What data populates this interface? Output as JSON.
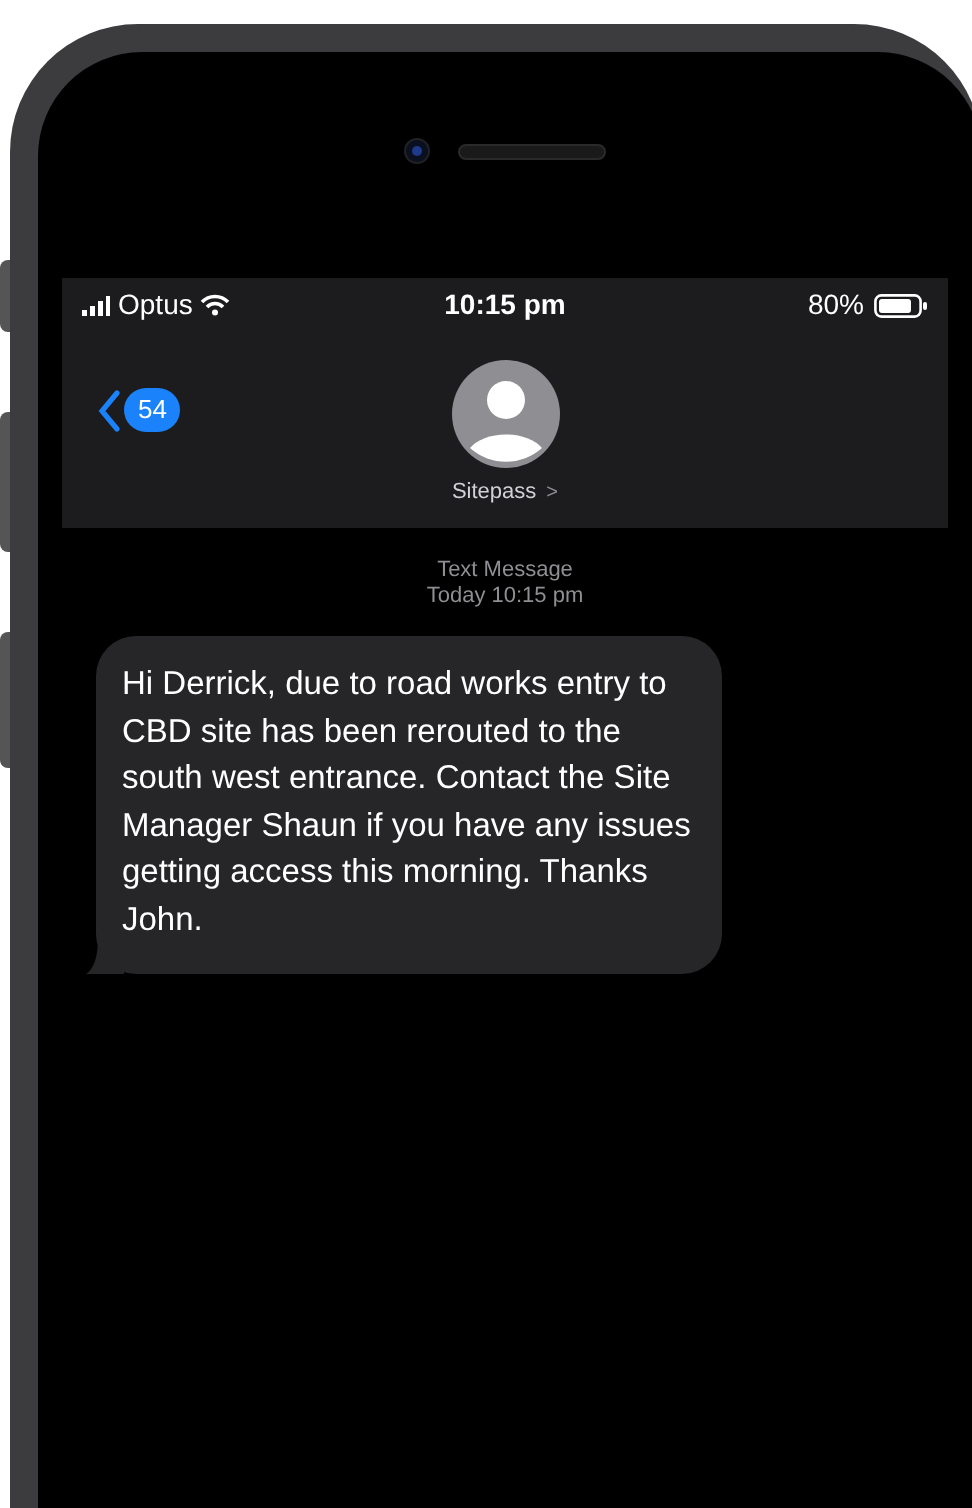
{
  "status_bar": {
    "carrier": "Optus",
    "time": "10:15 pm",
    "battery": "80%"
  },
  "header": {
    "back_count": "54",
    "contact": "Sitepass",
    "chevron": ">"
  },
  "conversation": {
    "label": "Text Message",
    "timestamp": "Today 10:15 pm",
    "messages": [
      {
        "kind": "incoming",
        "text": "Hi Derrick, due to road works entry to CBD site has been rerouted to the south west entrance. Contact the Site Manager Shaun if you have any issues getting access this morning. Thanks John."
      }
    ]
  }
}
